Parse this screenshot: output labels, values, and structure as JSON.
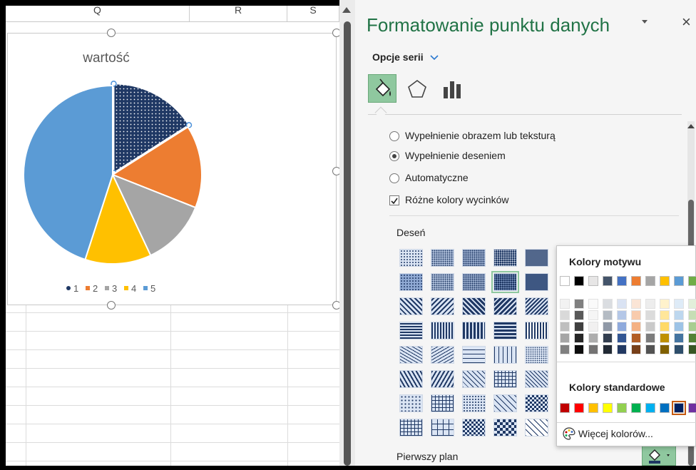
{
  "sheet": {
    "columns": [
      "Q",
      "R",
      "S"
    ]
  },
  "chart_data": {
    "type": "pie",
    "title": "wartość",
    "categories": [
      "1",
      "2",
      "3",
      "4",
      "5"
    ],
    "values": [
      16,
      15,
      12,
      12,
      45
    ],
    "colors": [
      "#1f3864",
      "#ed7d31",
      "#a5a5a5",
      "#ffc000",
      "#5b9bd5"
    ],
    "legend": "bottom"
  },
  "pane": {
    "title": "Formatowanie punktu danych",
    "dropdown_icon": "chevron-down-icon",
    "close_icon": "×",
    "series_options": "Opcje serii",
    "tabs": [
      "fill-line",
      "effects",
      "series-options"
    ],
    "fill_options": [
      {
        "label": "Wypełnienie obrazem lub teksturą",
        "selected": false
      },
      {
        "label": "Wypełnienie deseniem",
        "selected": true
      },
      {
        "label": "Automatyczne",
        "selected": false
      }
    ],
    "vary_colors": {
      "label": "Różne kolory wycinków",
      "checked": true
    },
    "pattern_label": "Deseń",
    "foreground_label": "Pierwszy plan"
  },
  "color_popup": {
    "theme_title": "Kolory motywu",
    "standard_title": "Kolory standardowe",
    "more_colors": "Więcej kolorów...",
    "theme_colors": [
      "#ffffff",
      "#000000",
      "#e7e6e6",
      "#44546a",
      "#4472c4",
      "#ed7d31",
      "#a5a5a5",
      "#ffc000",
      "#5b9bd5",
      "#70ad47"
    ],
    "standard_colors": [
      "#c00000",
      "#ff0000",
      "#ffc000",
      "#ffff00",
      "#92d050",
      "#00b050",
      "#00b0f0",
      "#0070c0",
      "#002060",
      "#7030a0"
    ],
    "selected_standard": 8
  }
}
